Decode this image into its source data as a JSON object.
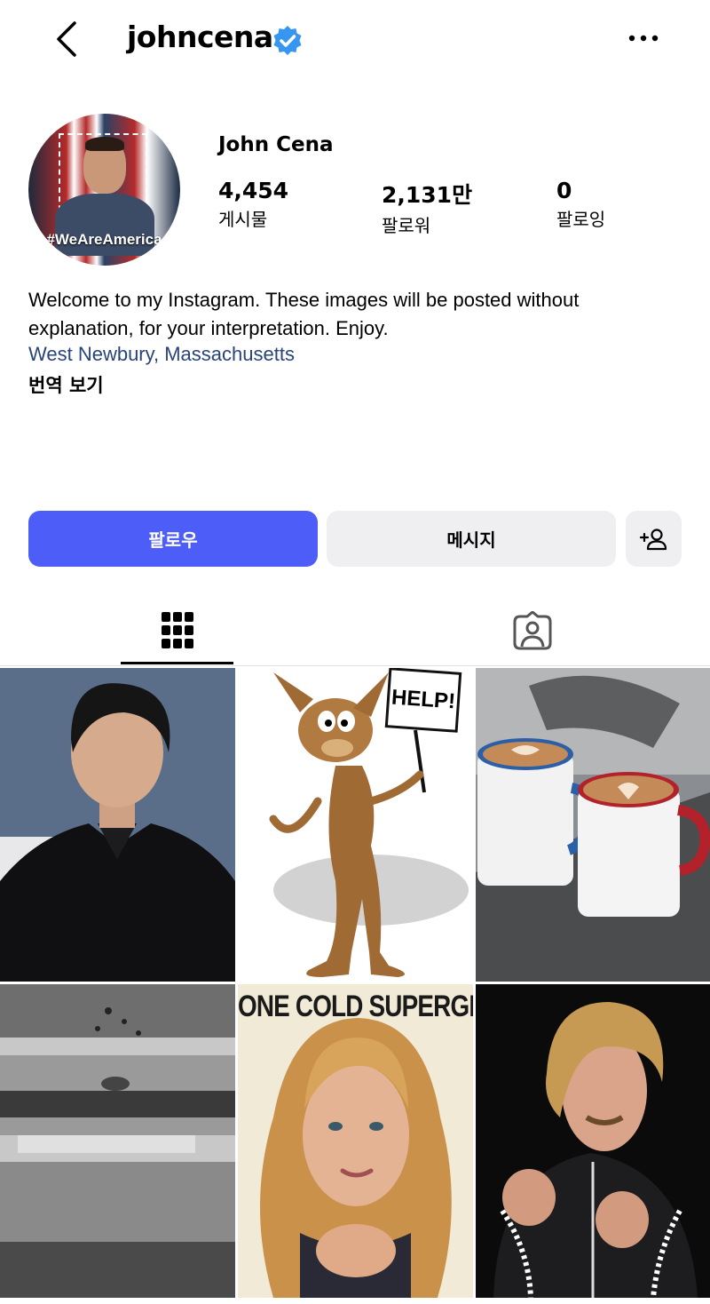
{
  "header": {
    "username": "johncena",
    "back_icon": "chevron-left-icon",
    "verified_icon": "verified-badge-icon",
    "more_icon": "more-dots-icon"
  },
  "profile": {
    "avatar_tag": "#WeAreAmerica",
    "full_name": "John Cena",
    "stats": [
      {
        "value": "4,454",
        "label": "게시물"
      },
      {
        "value": "2,131만",
        "label": "팔로워"
      },
      {
        "value": "0",
        "label": "팔로잉"
      }
    ],
    "bio": "Welcome to my Instagram. These images will be posted without explanation, for your interpretation. Enjoy.",
    "location": "West Newbury, Massachusetts",
    "translate_label": "번역 보기"
  },
  "actions": {
    "follow_label": "팔로우",
    "message_label": "메시지",
    "suggest_icon": "add-person-icon"
  },
  "tabs": {
    "grid_icon": "grid-icon",
    "tagged_icon": "tagged-person-icon"
  },
  "posts": {
    "sign_text": "HELP!",
    "poster_text": "ONE COLD SUPERGI"
  },
  "colors": {
    "follow_button": "#4c5ef7",
    "secondary_button": "#efeff1",
    "verified_badge": "#3797f0",
    "location_link": "#29447a"
  }
}
